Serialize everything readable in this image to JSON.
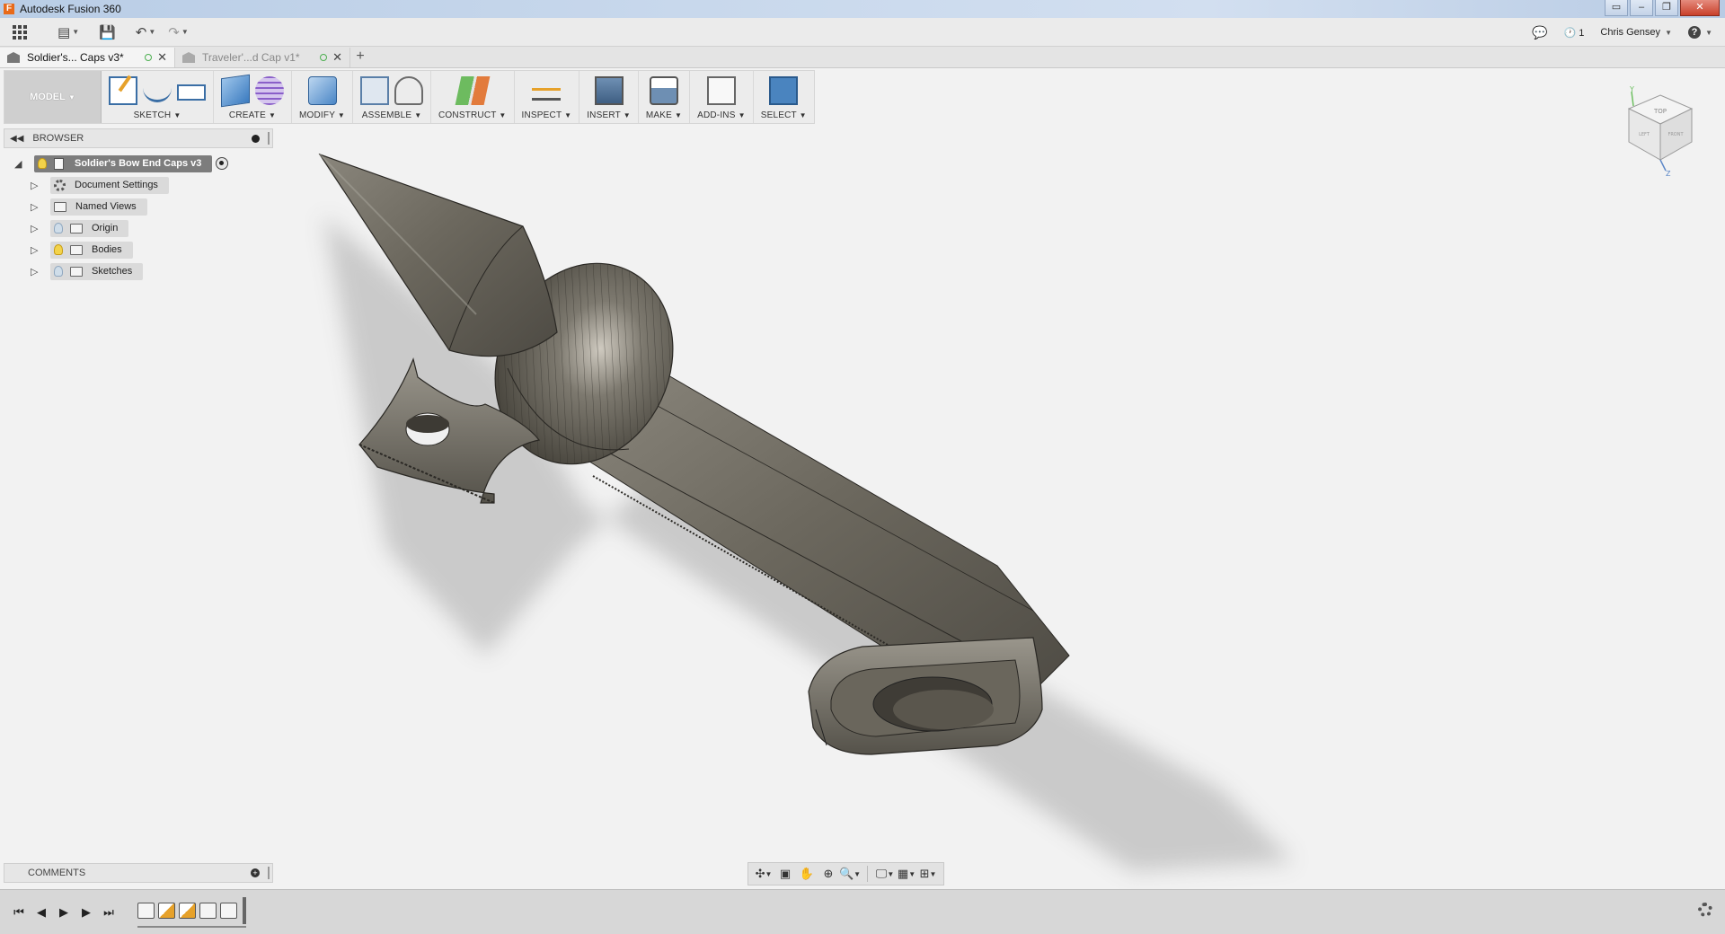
{
  "window": {
    "title": "Autodesk Fusion 360",
    "controls": [
      "▭",
      "–",
      "❐",
      "✕"
    ]
  },
  "quick_access": {
    "user": "Chris Gensey",
    "job_count": "1",
    "help": "?"
  },
  "tabs": [
    {
      "label": "Soldier's... Caps v3*",
      "active": true
    },
    {
      "label": "Traveler'...d Cap v1*",
      "active": false
    }
  ],
  "ribbon": {
    "workspace": "MODEL",
    "groups": [
      {
        "label": "SKETCH"
      },
      {
        "label": "CREATE"
      },
      {
        "label": "MODIFY"
      },
      {
        "label": "ASSEMBLE"
      },
      {
        "label": "CONSTRUCT"
      },
      {
        "label": "INSPECT"
      },
      {
        "label": "INSERT"
      },
      {
        "label": "MAKE"
      },
      {
        "label": "ADD-INS"
      },
      {
        "label": "SELECT"
      }
    ]
  },
  "browser": {
    "header": "BROWSER",
    "root": "Soldier's Bow End Caps v3",
    "items": [
      {
        "label": "Document Settings",
        "icon": "gear-icon"
      },
      {
        "label": "Named Views",
        "icon": "folder-icon"
      },
      {
        "label": "Origin",
        "icon": "folder-icon",
        "visible": false
      },
      {
        "label": "Bodies",
        "icon": "folder-icon",
        "visible": true
      },
      {
        "label": "Sketches",
        "icon": "folder-icon",
        "visible": false
      }
    ]
  },
  "comments": {
    "header": "COMMENTS"
  },
  "viewcube": {
    "top": "TOP",
    "front": "FRONT",
    "left": "LEFT",
    "axis_y": "Y",
    "axis_z": "Z"
  },
  "colors": {
    "accent": "#3a6ea5",
    "model": "#6b665c",
    "background": "#f2f2f2"
  }
}
